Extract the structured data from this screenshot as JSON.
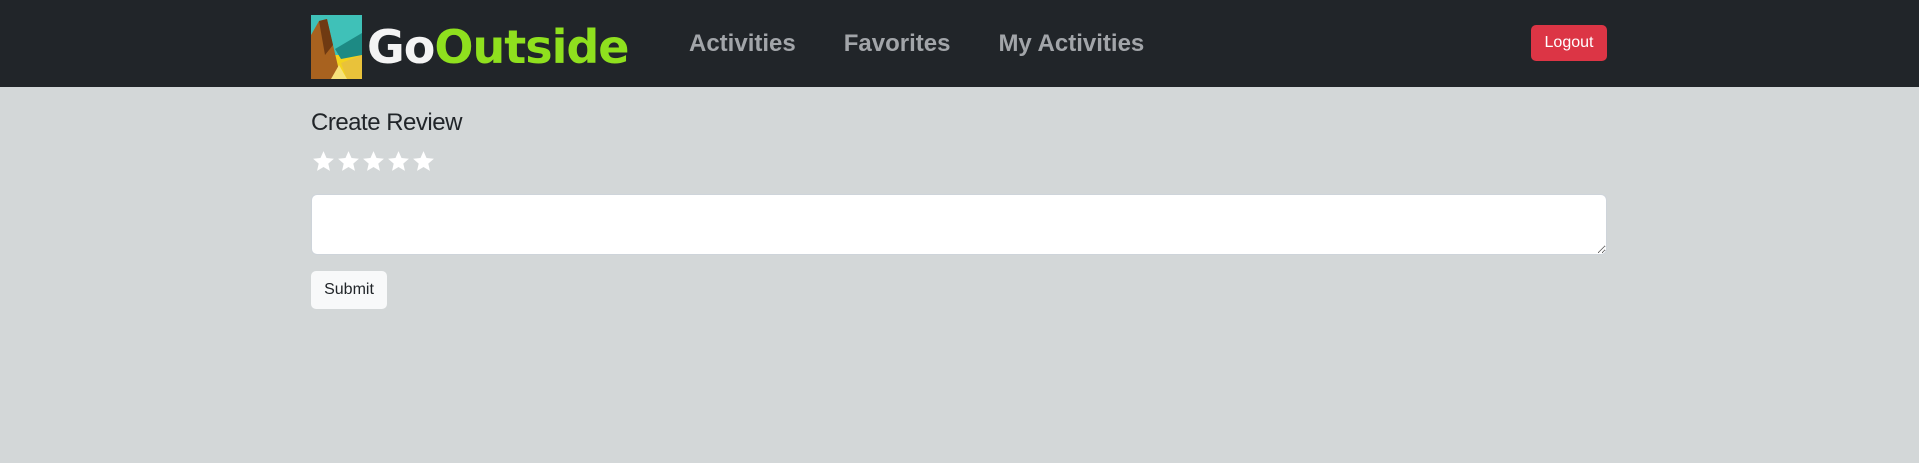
{
  "brand": {
    "name_part1": "Go",
    "name_part2": "Outside",
    "logo_icon": "mountain-landscape-logo"
  },
  "nav": {
    "links": [
      {
        "label": "Activities"
      },
      {
        "label": "Favorites"
      },
      {
        "label": "My Activities"
      }
    ],
    "logout_label": "Logout"
  },
  "review": {
    "title": "Create Review",
    "rating": 0,
    "max_rating": 5,
    "star_icon": "star-icon",
    "text_value": "",
    "submit_label": "Submit"
  },
  "colors": {
    "navbar_bg": "#212529",
    "page_bg": "#d3d7d8",
    "brand_accent": "#8fe01e",
    "logout_bg": "#dc3545"
  }
}
